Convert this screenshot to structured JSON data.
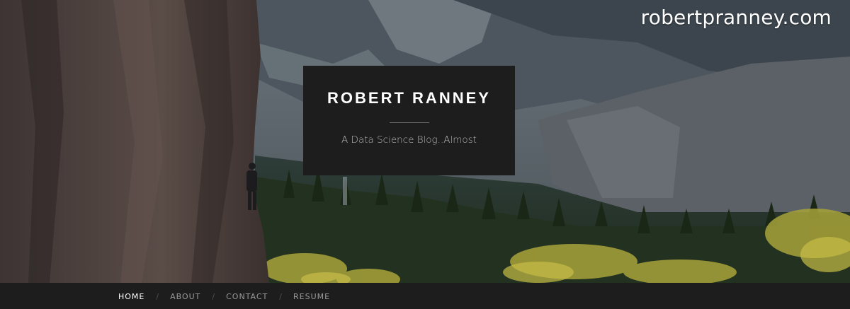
{
  "watermark": "robertpranney.com",
  "header": {
    "title": "ROBERT RANNEY",
    "tagline": "A Data Science Blog..Almost"
  },
  "nav": {
    "items": [
      {
        "label": "HOME",
        "active": true
      },
      {
        "label": "ABOUT",
        "active": false
      },
      {
        "label": "CONTACT",
        "active": false
      },
      {
        "label": "RESUME",
        "active": false
      }
    ],
    "separator": "/"
  },
  "colors": {
    "box_background": "#1d1d1d",
    "nav_background": "#1d1d1d",
    "title_text": "#ffffff",
    "tagline_text": "#b5b5b5",
    "nav_text": "#9a9a9a",
    "nav_active": "#ffffff"
  }
}
